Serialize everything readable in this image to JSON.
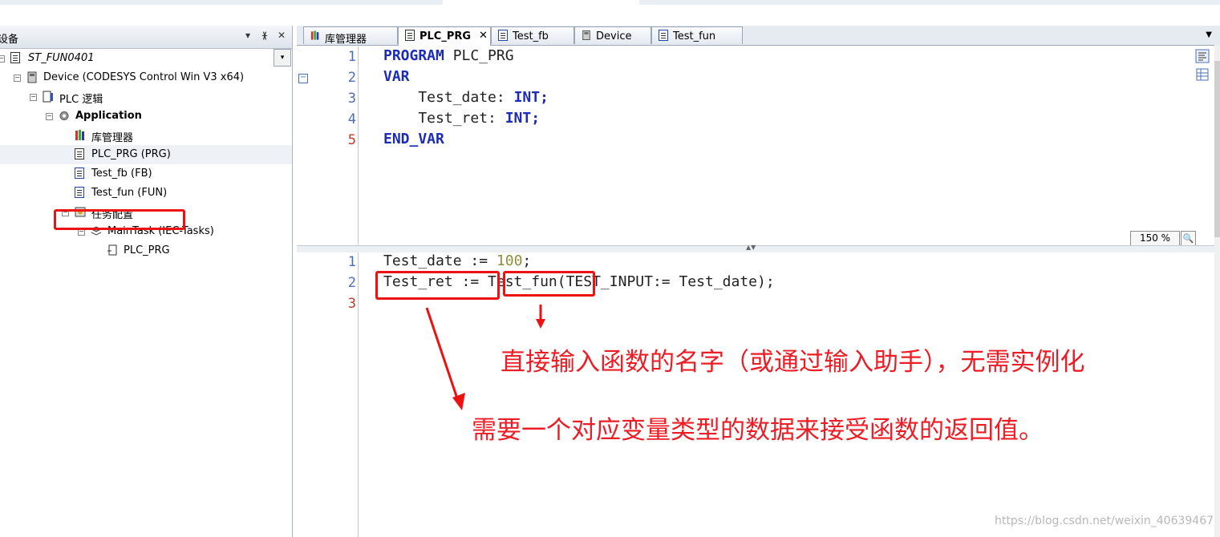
{
  "device_panel": {
    "title": "设备",
    "controls": {
      "menu": "▾",
      "pin": "ᚕ",
      "close": "✕"
    },
    "project": "ST_FUN0401",
    "tree": [
      {
        "label": "Device (CODESYS Control Win V3 x64)"
      },
      {
        "label": "PLC 逻辑"
      },
      {
        "label": "Application"
      },
      {
        "label": "库管理器"
      },
      {
        "label": "PLC_PRG (PRG)"
      },
      {
        "label": "Test_fb (FB)"
      },
      {
        "label": "Test_fun (FUN)"
      },
      {
        "label": "任务配置"
      },
      {
        "label": "MainTask (IEC-Tasks)"
      },
      {
        "label": "PLC_PRG"
      }
    ]
  },
  "tabs": [
    {
      "label": "库管理器",
      "active": false
    },
    {
      "label": "PLC_PRG",
      "active": true,
      "close": "✕"
    },
    {
      "label": "Test_fb",
      "active": false
    },
    {
      "label": "Device",
      "active": false
    },
    {
      "label": "Test_fun",
      "active": false
    }
  ],
  "declaration": {
    "line_numbers": [
      "1",
      "2",
      "3",
      "4",
      "5"
    ],
    "lines": [
      {
        "kw": "PROGRAM",
        "rest": " PLC_PRG"
      },
      {
        "kw": "VAR",
        "rest": ""
      },
      {
        "name": "    Test_date: ",
        "type": "INT",
        "tail": ";"
      },
      {
        "name": "    Test_ret: ",
        "type": "INT",
        "tail": ";"
      },
      {
        "kw": "END_VAR",
        "rest": ""
      }
    ]
  },
  "implementation": {
    "line_numbers": [
      "1",
      "2",
      "3"
    ],
    "line1": {
      "a": "Test_date := ",
      "num": "100",
      "b": ";"
    },
    "line2": {
      "a": "Test_ret := ",
      "b": "Test_fun",
      "c": "(TEST_INPUT:= Test_date);"
    }
  },
  "zoom": "150 %",
  "annotations": {
    "note1": "直接输入函数的名字（或通过输入助手），无需实例化",
    "note2": "需要一个对应变量类型的数据来接受函数的返回值。"
  },
  "watermark": "https://blog.csdn.net/weixin_40639467",
  "colors": {
    "annotation": "#ee1111",
    "keyword": "#1c2bb8",
    "number": "#8f8f3a"
  }
}
